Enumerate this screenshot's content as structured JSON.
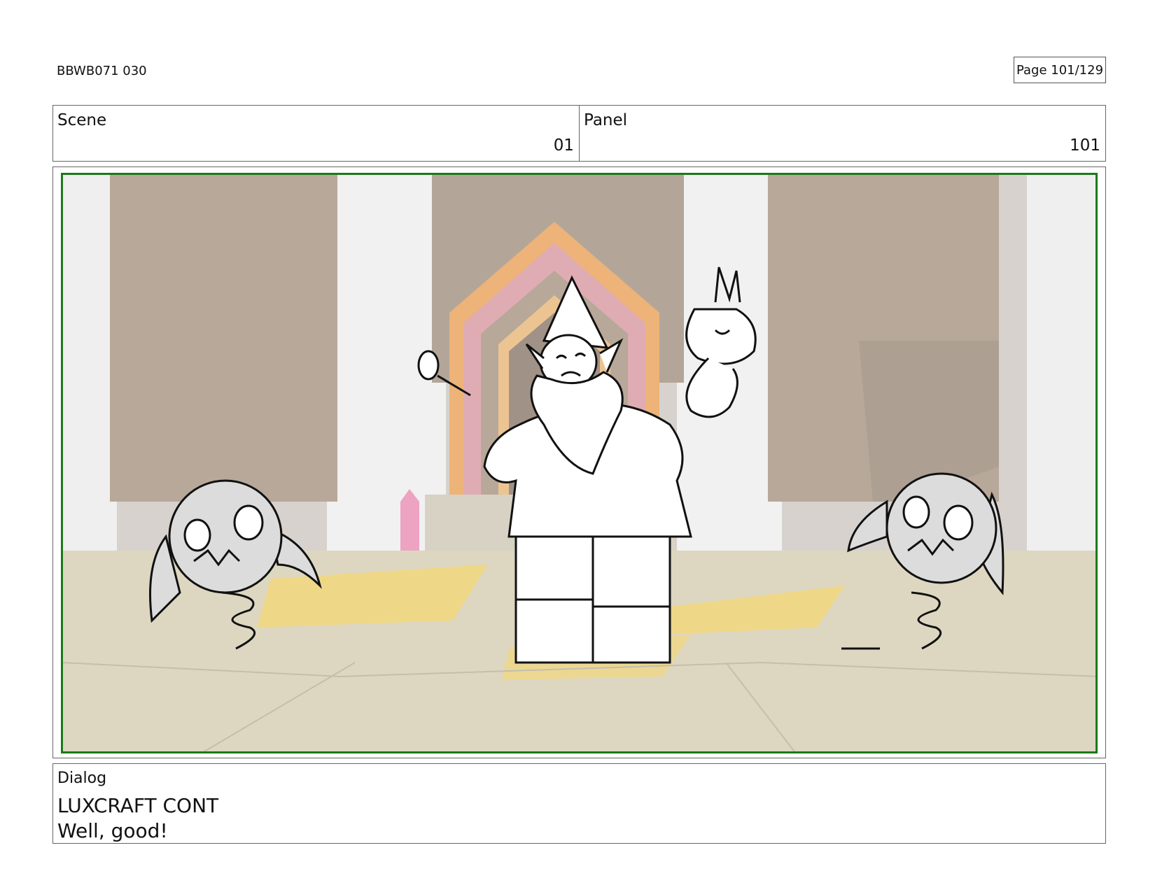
{
  "header": {
    "doc_code": "BBWB071 030",
    "page_label": "Page 101/129"
  },
  "info": {
    "scene_label": "Scene",
    "scene_value": "01",
    "panel_label": "Panel",
    "panel_value": "101"
  },
  "dialog": {
    "label": "Dialog",
    "lines": [
      "LUXCRAFT CONT",
      "Well, good!"
    ]
  },
  "colors": {
    "frame_border": "#1a7a1a",
    "wall": "#a39080",
    "pillar": "#e6e6e6",
    "floor": "#d6cfb4",
    "floor_gold": "#f0cf62",
    "door_orange": "#e9a35c",
    "door_pink": "#d89aa3",
    "crystal": "#ea8fb5",
    "sketch_fill": "#dcdcdc"
  }
}
